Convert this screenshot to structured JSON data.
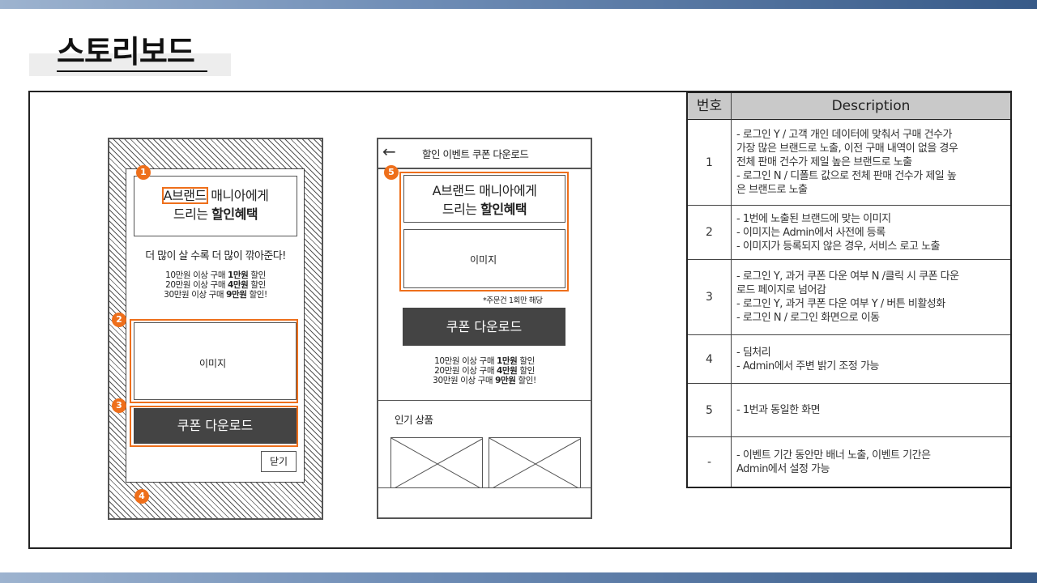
{
  "page": {
    "title": "스토리보드"
  },
  "screen1": {
    "headline_line1_prefix": "A브랜드",
    "headline_line1_rest": " 매니아에게",
    "headline_line2_prefix": "드리는 ",
    "headline_line2_bold": "할인혜택",
    "tagline": "더 많이 살 수록 더 많이 깎아준다!",
    "tiers": [
      {
        "prefix": "10만원 이상 구매 ",
        "bold": "1만원",
        "suffix": " 할인"
      },
      {
        "prefix": "20만원 이상 구매 ",
        "bold": "4만원",
        "suffix": " 할인"
      },
      {
        "prefix": "30만원 이상 구매 ",
        "bold": "9만원",
        "suffix": " 할인!"
      }
    ],
    "image_label": "이미지",
    "coupon_button": "쿠폰 다운로드",
    "close_button": "닫기",
    "badges": [
      "1",
      "2",
      "3",
      "4"
    ]
  },
  "screen2": {
    "back_arrow": "←",
    "header_title": "할인 이벤트 쿠폰 다운로드",
    "headline_line1": "A브랜드 매니아에게",
    "headline_line2_prefix": "드리는 ",
    "headline_line2_bold": "할인혜택",
    "image_label": "이미지",
    "note": "*주문건 1회만 해당",
    "coupon_button": "쿠폰 다운로드",
    "tiers": [
      {
        "prefix": "10만원 이상 구매 ",
        "bold": "1만원",
        "suffix": " 할인"
      },
      {
        "prefix": "20만원 이상 구매 ",
        "bold": "4만원",
        "suffix": " 할인"
      },
      {
        "prefix": "30만원 이상 구매 ",
        "bold": "9만원",
        "suffix": " 할인!"
      }
    ],
    "popular_title": "인기 상품",
    "badge": "5"
  },
  "table": {
    "headers": [
      "번호",
      "Description"
    ],
    "rows": [
      {
        "num": "1",
        "lines": [
          "- 로그인 Y / 고객 개인 데이터에 맞춰서 구매 건수가",
          "가장 많은 브랜드로 노출, 이전 구매 내역이 없을 경우",
          "전체 판매 건수가 제일 높은 브랜드로 노출",
          "- 로그인 N / 디폴트 값으로 전체 판매 건수가 제일 높",
          "은 브랜드로 노출"
        ]
      },
      {
        "num": "2",
        "lines": [
          "- 1번에 노출된 브랜드에 맞는 이미지",
          "- 이미지는 Admin에서 사전에 등록",
          "- 이미지가 등록되지 않은 경우, 서비스 로고 노출"
        ]
      },
      {
        "num": "3",
        "lines": [
          "- 로그인 Y, 과거 쿠폰 다운 여부 N /클릭 시 쿠폰 다운",
          "로드 페이지로 넘어감",
          "- 로그인 Y, 과거 쿠폰 다운 여부 Y / 버튼 비활성화",
          "- 로그인 N / 로그인 화면으로 이동"
        ]
      },
      {
        "num": "4",
        "lines": [
          "- 딤처리",
          "- Admin에서 주변 밝기 조정 가능"
        ]
      },
      {
        "num": "5",
        "lines": [
          "- 1번과 동일한 화면"
        ]
      },
      {
        "num": "-",
        "lines": [
          "- 이벤트 기간 동안만 배너 노출, 이벤트 기간은",
          "Admin에서 설정 가능"
        ]
      }
    ]
  },
  "colors": {
    "accent": "#ee6f1b",
    "button": "#444444",
    "header_bar": "#375a88"
  }
}
